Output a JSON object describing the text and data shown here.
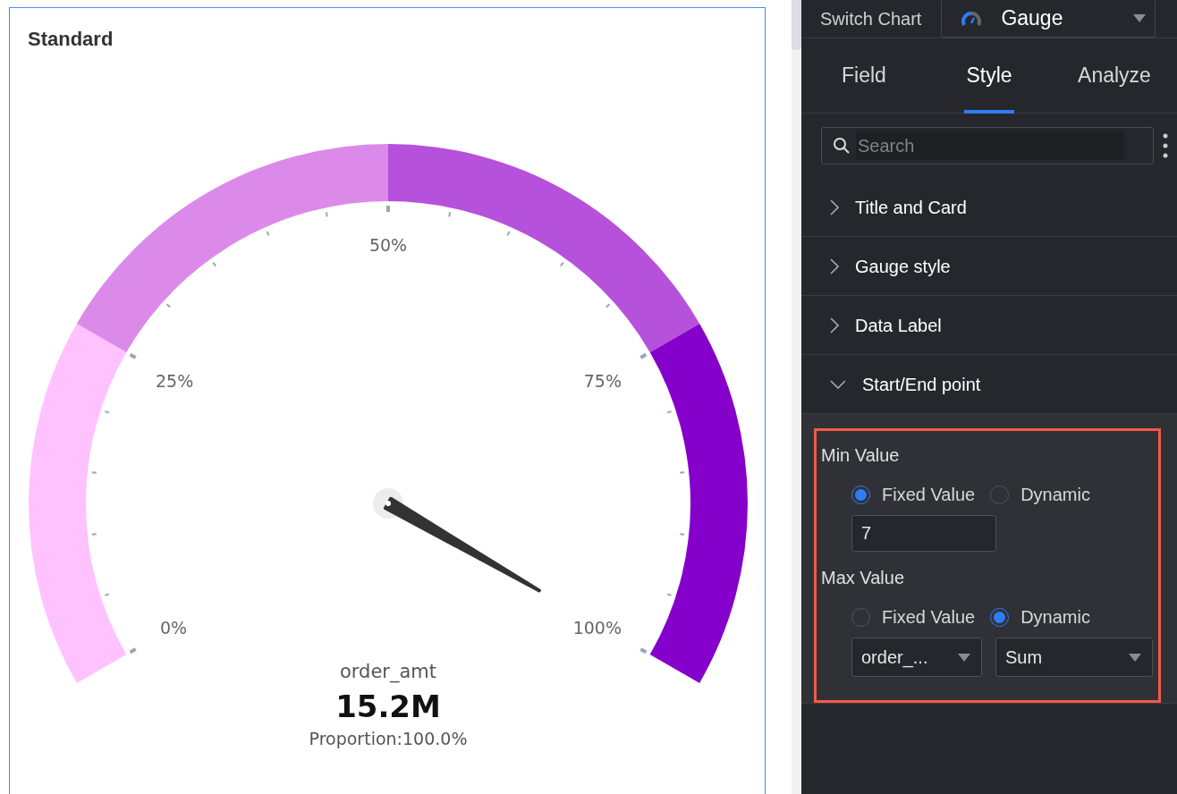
{
  "chart_card": {
    "title": "Standard",
    "gauge": {
      "level": 1,
      "segments": [
        {
          "color": "#ffc2ff"
        },
        {
          "color": "#dc8aea"
        },
        {
          "color": "#b551db"
        },
        {
          "color": "#8600cc"
        }
      ],
      "tick_labels": [
        "0%",
        "25%",
        "50%",
        "75%",
        "100%"
      ],
      "metric_name": "order_amt",
      "value": "15.2M",
      "proportion": "Proportion:100.0%"
    }
  },
  "panel": {
    "switch_chart": {
      "label": "Switch Chart",
      "value": "Gauge"
    },
    "tabs": [
      {
        "label": "Field",
        "selected": false
      },
      {
        "label": "Style",
        "selected": true
      },
      {
        "label": "Analyze",
        "selected": false
      }
    ],
    "search": {
      "placeholder": "Search"
    },
    "sections": [
      {
        "title": "Title and Card",
        "expanded": false
      },
      {
        "title": "Gauge style",
        "expanded": false
      },
      {
        "title": "Data Label",
        "expanded": false
      },
      {
        "title": "Start/End point",
        "expanded": true,
        "groups": [
          {
            "label": "Min Value",
            "options": [
              {
                "label": "Fixed Value",
                "selected": true
              },
              {
                "label": "Dynamic",
                "selected": false
              }
            ],
            "controls": [
              {
                "kind": "input",
                "value": "7"
              }
            ]
          },
          {
            "label": "Max Value",
            "options": [
              {
                "label": "Fixed Value",
                "selected": false
              },
              {
                "label": "Dynamic",
                "selected": true
              }
            ],
            "controls": [
              {
                "kind": "select",
                "value": "order_..."
              },
              {
                "kind": "select",
                "value": "Sum"
              }
            ]
          }
        ]
      }
    ]
  }
}
